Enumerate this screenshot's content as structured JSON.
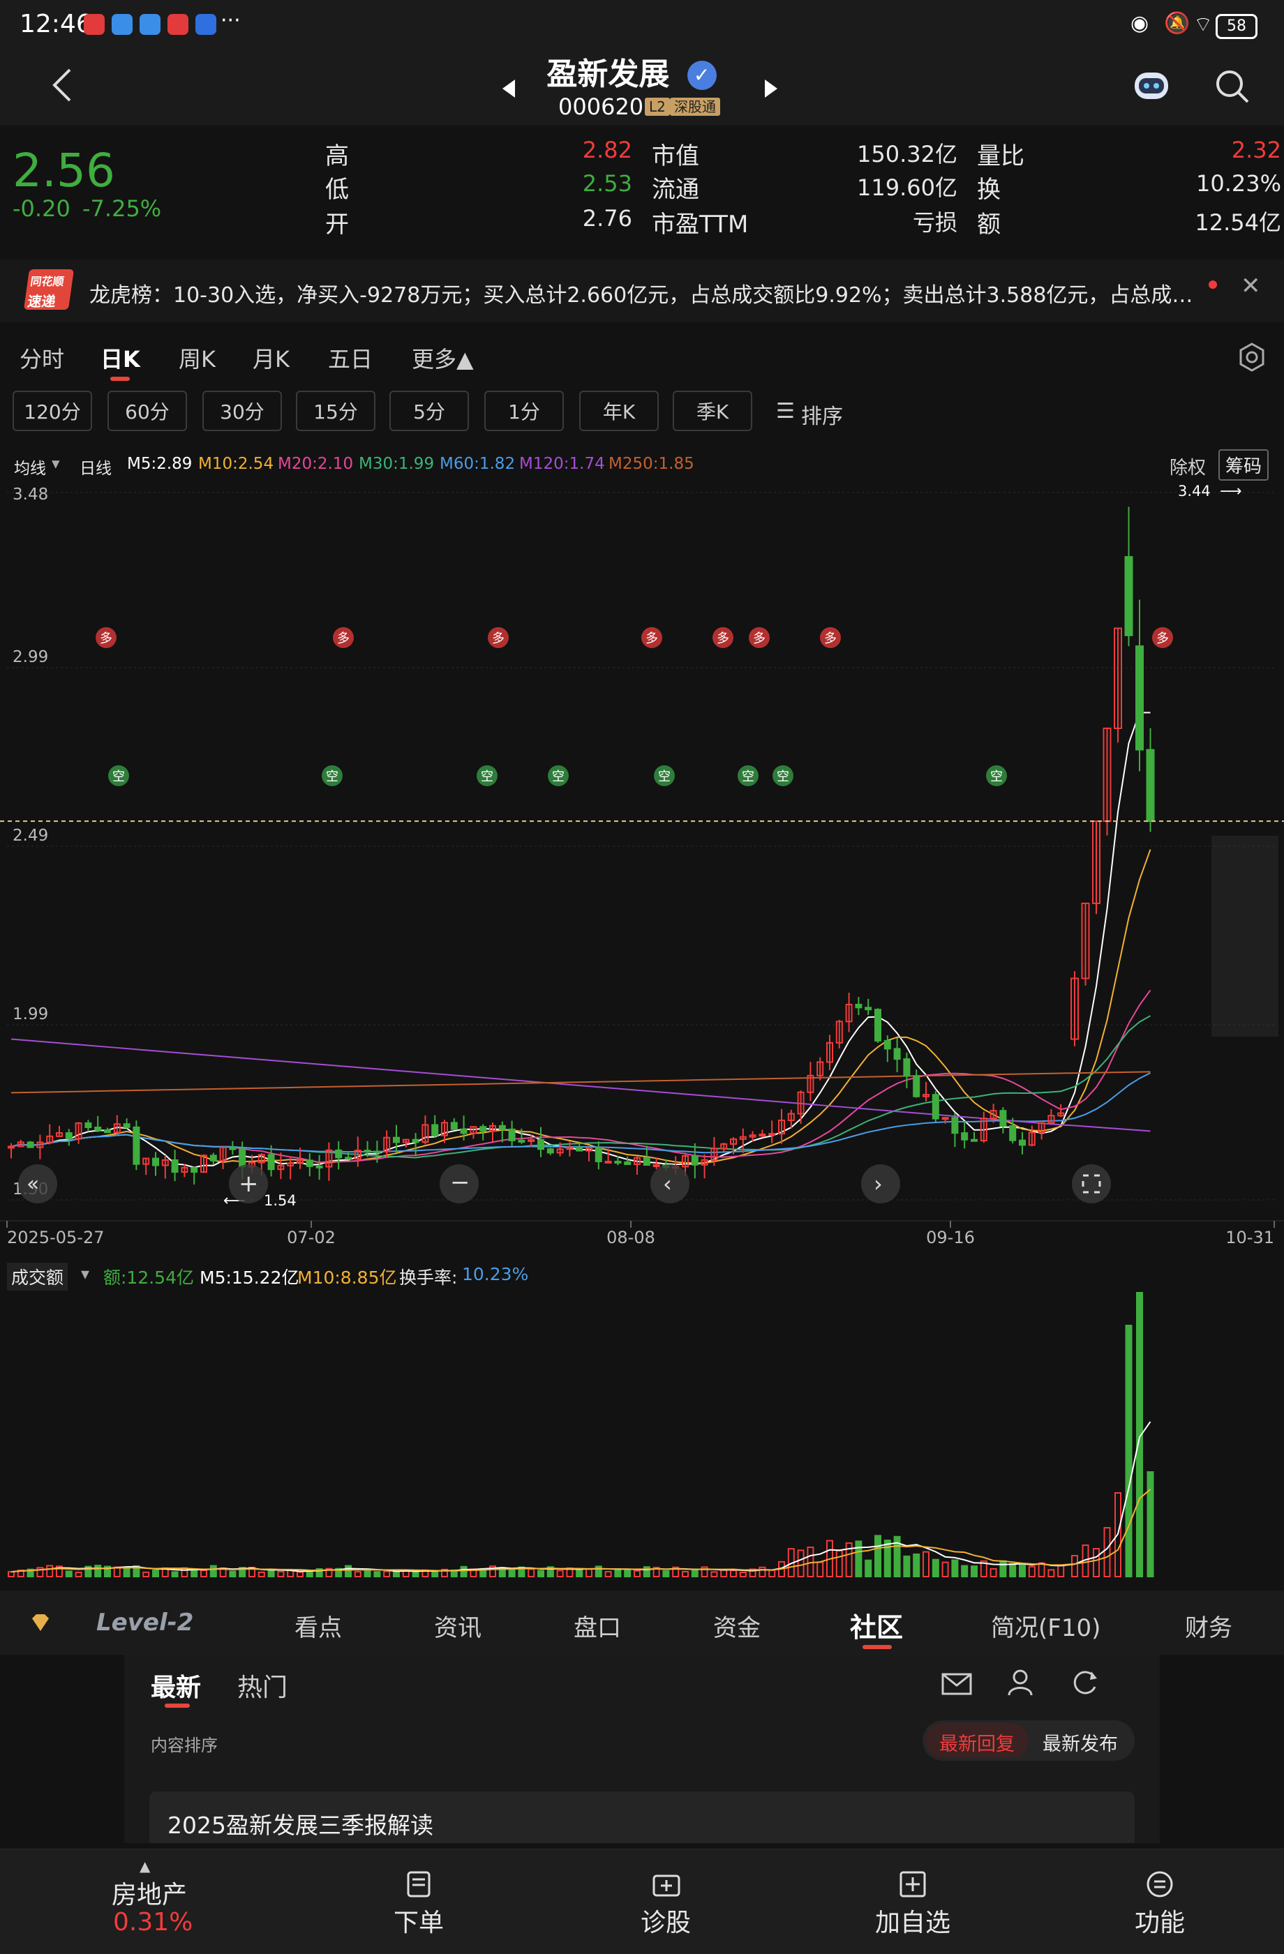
{
  "status_bar": {
    "time": "12:46",
    "battery": "58",
    "more": "···"
  },
  "header": {
    "stock_name": "盈新发展",
    "stock_code": "000620",
    "tag_level": "L2",
    "tag_market": "深股通"
  },
  "quote": {
    "price": "2.56",
    "change": "-0.20",
    "change_pct": "-7.25%",
    "high_label": "高",
    "high": "2.82",
    "low_label": "低",
    "low": "2.53",
    "open_label": "开",
    "open": "2.76",
    "mktcap_label": "市值",
    "mktcap": "150.32亿",
    "float_label": "流通",
    "float": "119.60亿",
    "pe_label": "市盈TTM",
    "pe": "亏损",
    "volratio_label": "量比",
    "volratio": "2.32",
    "turnover_label": "换",
    "turnover": "10.23%",
    "amount_label": "额",
    "amount": "12.54亿"
  },
  "dragon_list": {
    "logo_top": "同花顺",
    "logo_bottom": "速递",
    "text": "龙虎榜：10-30入选，净买入-9278万元；买入总计2.660亿元，占总成交额比9.92%；卖出总计3.588亿元，占总成…"
  },
  "period_tabs": [
    "分时",
    "日K",
    "周K",
    "月K",
    "五日",
    "更多▲"
  ],
  "active_period": "日K",
  "interval_buttons": [
    "120分",
    "60分",
    "30分",
    "15分",
    "5分",
    "1分",
    "年K",
    "季K"
  ],
  "sort_label": "排序",
  "ma_legend": {
    "type": "均线",
    "line": "日线",
    "m5": "M5:2.89",
    "m10": "M10:2.54",
    "m20": "M20:2.10",
    "m30": "M30:1.99",
    "m60": "M60:1.82",
    "m120": "M120:1.74",
    "m250": "M250:1.85",
    "exright": "除权",
    "chips": "筹码"
  },
  "colors": {
    "up": "#f23b3b",
    "down": "#3fae3f",
    "m5": "#ffffff",
    "m10": "#f2b134",
    "m20": "#e6479a",
    "m30": "#3bb37a",
    "m60": "#4a9de8",
    "m120": "#a64dd6",
    "m250": "#c4612e",
    "accent": "#e8463a"
  },
  "chart_data": {
    "type": "candlestick",
    "title": "",
    "y_ticks": [
      "3.48",
      "2.99",
      "2.49",
      "1.99",
      "1.50"
    ],
    "ylim": [
      1.5,
      3.48
    ],
    "x_ticks": [
      "2025-05-27",
      "07-02",
      "08-08",
      "09-16",
      "10-31"
    ],
    "max_label": "3.44",
    "min_label": "1.54",
    "current_price": 2.56,
    "recent_candles": [
      {
        "open": 1.95,
        "close": 2.12,
        "high": 2.14,
        "low": 1.93
      },
      {
        "open": 2.12,
        "close": 2.33,
        "high": 2.33,
        "low": 2.1
      },
      {
        "open": 2.33,
        "close": 2.56,
        "high": 2.56,
        "low": 2.3
      },
      {
        "open": 2.56,
        "close": 2.82,
        "high": 2.82,
        "low": 2.52
      },
      {
        "open": 2.82,
        "close": 3.1,
        "high": 3.1,
        "low": 2.78
      },
      {
        "open": 3.3,
        "close": 3.08,
        "high": 3.44,
        "low": 3.05
      },
      {
        "open": 3.05,
        "close": 2.76,
        "high": 3.18,
        "low": 2.7
      },
      {
        "open": 2.76,
        "close": 2.56,
        "high": 2.82,
        "low": 2.53
      }
    ],
    "signals": {
      "short": "空",
      "long": "多"
    }
  },
  "volume_legend": {
    "type": "成交额",
    "amount": "额:12.54亿",
    "m5": "M5:15.22亿",
    "m10": "M10:8.85亿",
    "turnover_label": "换手率:",
    "turnover": "10.23%"
  },
  "main_tabs": [
    "Level-2",
    "看点",
    "资讯",
    "盘口",
    "资金",
    "社区",
    "简况(F10)",
    "财务"
  ],
  "active_main_tab": "社区",
  "community": {
    "tabs": [
      "最新",
      "热门"
    ],
    "sort_label": "内容排序",
    "sort_options": [
      "最新回复",
      "最新发布"
    ],
    "first_post": "2025盈新发展三季报解读"
  },
  "bottom_bar": {
    "sector": "房地产",
    "sector_change": "0.31%",
    "actions": [
      "下单",
      "诊股",
      "加自选",
      "功能"
    ]
  }
}
